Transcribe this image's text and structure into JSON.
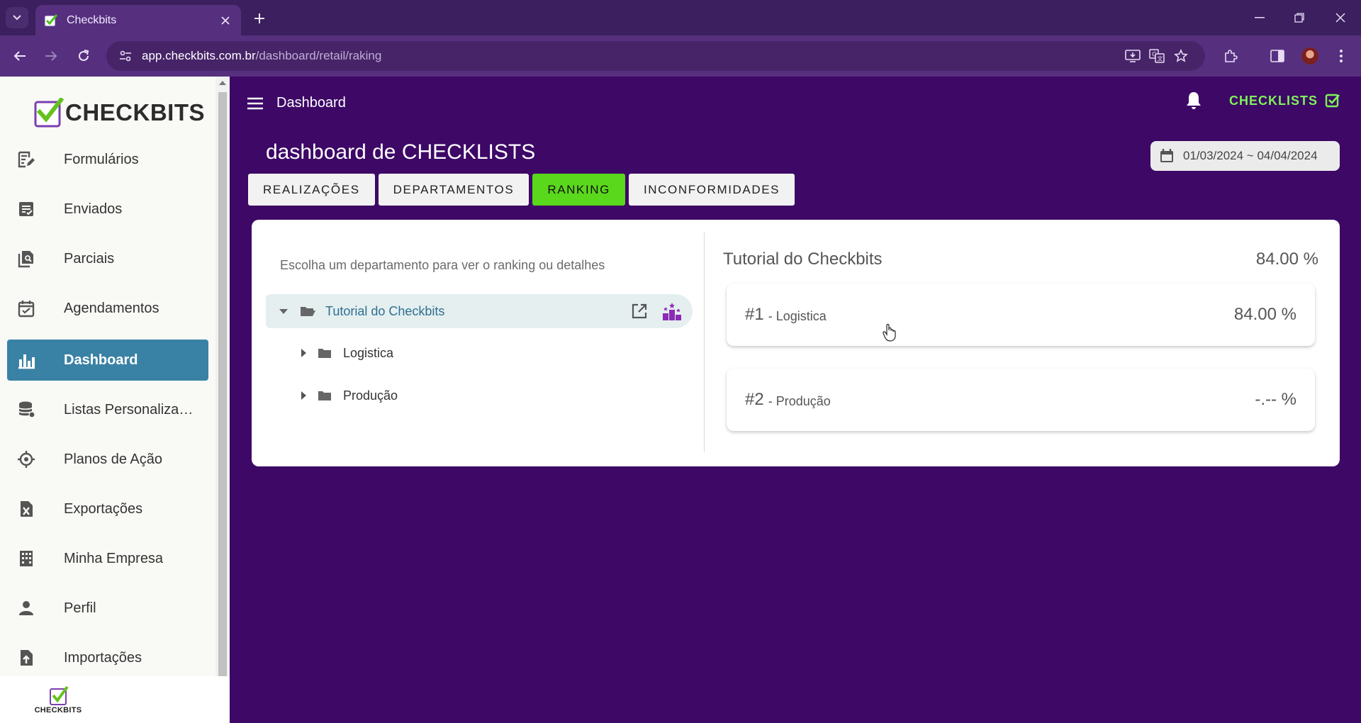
{
  "browser": {
    "tab_title": "Checkbits",
    "url_host": "app.checkbits.com.br",
    "url_path": "/dashboard/retail/raking"
  },
  "app": {
    "logo_text": "CHECKBITS",
    "header_title": "Dashboard",
    "checklists_label": "CHECKLISTS",
    "page_title": "dashboard de CHECKLISTS",
    "date_range": "01/03/2024 ~ 04/04/2024"
  },
  "sidebar": {
    "items": [
      {
        "label": "Formulários",
        "icon": "form-edit-icon"
      },
      {
        "label": "Enviados",
        "icon": "sent-list-icon"
      },
      {
        "label": "Parciais",
        "icon": "partial-docs-icon"
      },
      {
        "label": "Agendamentos",
        "icon": "calendar-check-icon"
      },
      {
        "label": "Dashboard",
        "icon": "bar-chart-icon",
        "active": true
      },
      {
        "label": "Listas Personalizadas",
        "icon": "database-icon"
      },
      {
        "label": "Planos de Ação",
        "icon": "crosshair-icon"
      },
      {
        "label": "Exportações",
        "icon": "excel-file-icon"
      },
      {
        "label": "Minha Empresa",
        "icon": "building-icon"
      },
      {
        "label": "Perfil",
        "icon": "person-icon"
      },
      {
        "label": "Importações",
        "icon": "file-upload-icon"
      }
    ]
  },
  "tabs": [
    {
      "label": "REALIZAÇÕES"
    },
    {
      "label": "DEPARTAMENTOS"
    },
    {
      "label": "RANKING",
      "active": true
    },
    {
      "label": "INCONFORMIDADES"
    }
  ],
  "tree": {
    "hint": "Escolha um departamento para ver o ranking ou detalhes",
    "root": "Tutorial do Checkbits",
    "children": [
      "Logistica",
      "Produção"
    ]
  },
  "ranking": {
    "title": "Tutorial do Checkbits",
    "total": "84.00 %",
    "entries": [
      {
        "position": "#1",
        "department": "- Logistica",
        "value": "84.00 %"
      },
      {
        "position": "#2",
        "department": "- Produção",
        "value": "-.-- %"
      }
    ]
  },
  "colors": {
    "background": "#3d0866",
    "active_tab": "#5ad81b",
    "active_nav": "#3a82a5",
    "checklists_accent": "#7ff25a"
  }
}
